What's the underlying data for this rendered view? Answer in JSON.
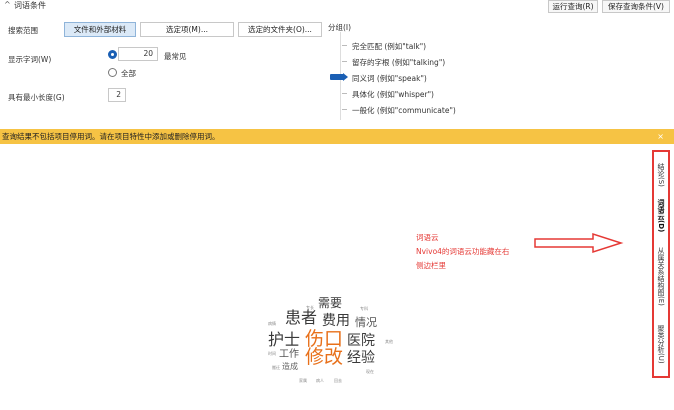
{
  "header": {
    "collapse_glyph": "^",
    "section_title": "词语条件",
    "run_query": "运行查询(R)",
    "save_query": "保存查询条件(V)"
  },
  "criteria": {
    "search_scope_label": "搜索范围",
    "scope_buttons": [
      "文件和外部材料",
      "选定项(M)...",
      "选定的文件夹(O)..."
    ],
    "display_words_label": "显示字词(W)",
    "display_count": "20",
    "most_frequent": "最常见",
    "all": "全部",
    "min_length_label": "具有最小长度(G)",
    "min_length": "2"
  },
  "grouping": {
    "title": "分组(I)",
    "items": [
      "完全匹配 (例如\"talk\")",
      "留存的字根 (例如\"talking\")",
      "同义词 (例如\"speak\")",
      "具体化 (例如\"whisper\")",
      "一般化 (例如\"communicate\")"
    ],
    "selected_index": 2
  },
  "infobar": {
    "message": "查询结果不包括项目停用词。请在项目特性中添加或删除停用词。",
    "close": "×"
  },
  "annotation": {
    "line1": "词语云",
    "line2": "Nvivo4的词语云功能藏在右",
    "line3": "侧边栏里"
  },
  "word_cloud": {
    "words": [
      "专长",
      "需要",
      "专科",
      "病情",
      "患者",
      "费用",
      "情况",
      "护士",
      "伤口",
      "医院",
      "时间",
      "工作",
      "修改",
      "经验",
      "造成",
      "家属",
      "病人",
      "回去",
      "搬迁",
      "其他",
      "现在"
    ]
  },
  "side_tabs": [
    "结论(S)",
    "词语云(D)",
    "从属关系结构图(E)",
    "聚类分析(U)"
  ],
  "colors": {
    "accent_red": "#e53935",
    "infobar_yellow": "#f6c344",
    "cloud_dark": "#3a3a3a",
    "cloud_orange": "#e8701a"
  }
}
